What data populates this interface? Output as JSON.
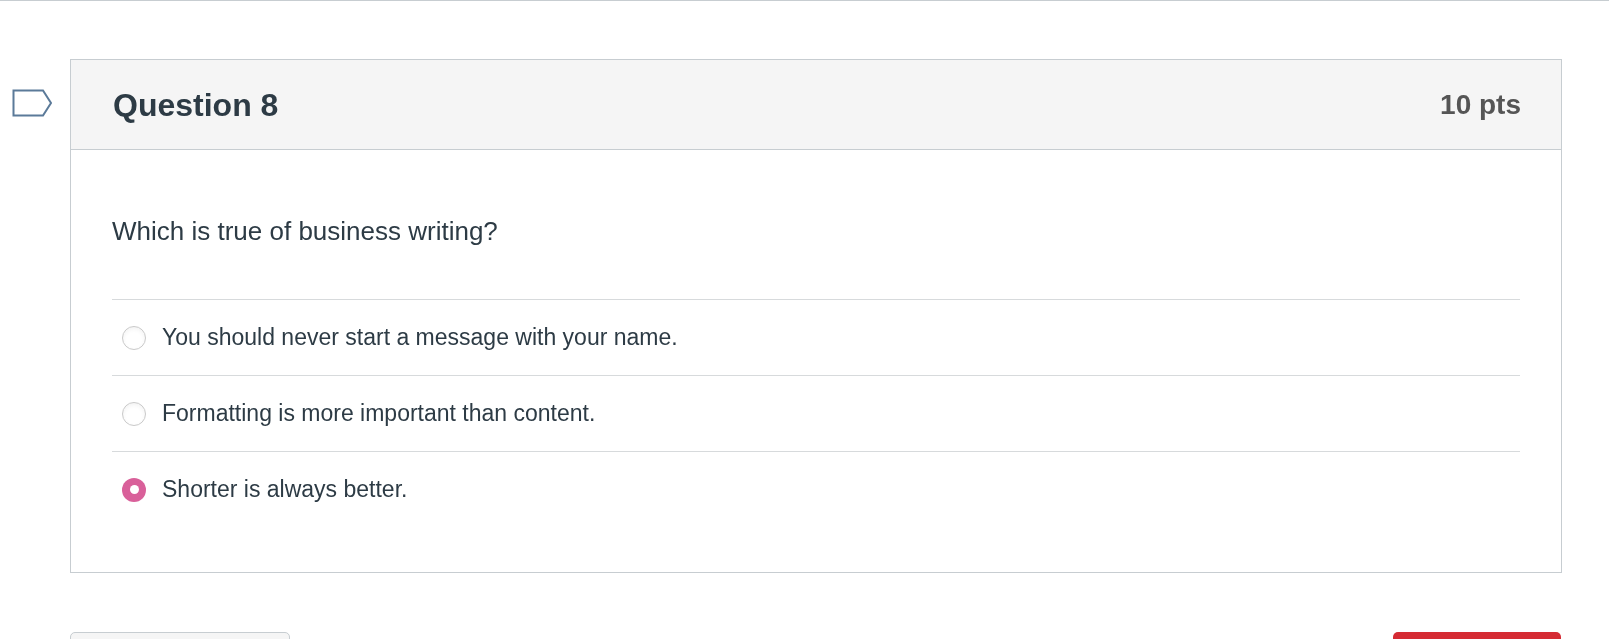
{
  "question": {
    "title": "Question 8",
    "points": "10 pts",
    "prompt": "Which is true of business writing?",
    "answers": [
      {
        "label": "You should never start a message with your name.",
        "selected": false
      },
      {
        "label": "Formatting is more important than content.",
        "selected": false
      },
      {
        "label": "Shorter is always better.",
        "selected": true
      }
    ]
  }
}
